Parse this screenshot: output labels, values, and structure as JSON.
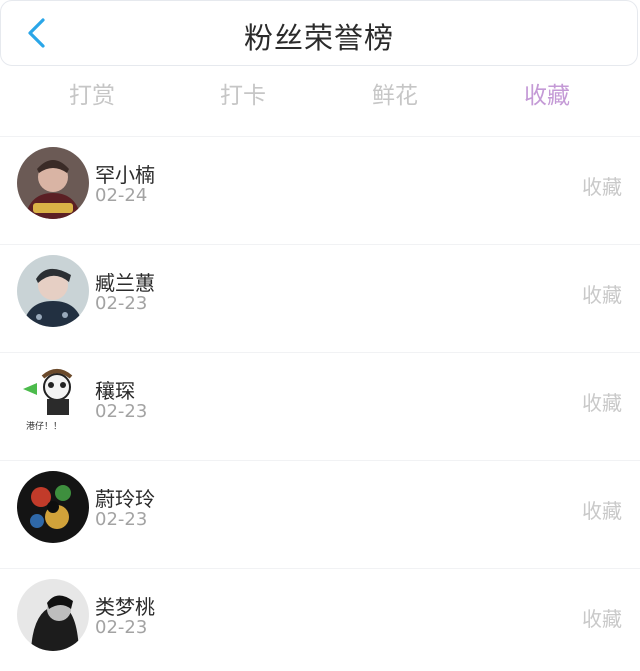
{
  "header": {
    "title": "粉丝荣誉榜",
    "back_icon": "chevron-left-icon",
    "accent_color": "#2aa6e8"
  },
  "tabs": [
    {
      "label": "打赏",
      "active": false
    },
    {
      "label": "打卡",
      "active": false
    },
    {
      "label": "鲜花",
      "active": false
    },
    {
      "label": "收藏",
      "active": true
    }
  ],
  "active_tab_color": "#c49ad6",
  "list": [
    {
      "name": "罕小楠",
      "date": "02-24",
      "action": "收藏"
    },
    {
      "name": "臧兰蕙",
      "date": "02-23",
      "action": "收藏"
    },
    {
      "name": "穰琛",
      "date": "02-23",
      "action": "收藏"
    },
    {
      "name": "蔚玲玲",
      "date": "02-23",
      "action": "收藏"
    },
    {
      "name": "类梦桃",
      "date": "02-23",
      "action": "收藏"
    }
  ]
}
